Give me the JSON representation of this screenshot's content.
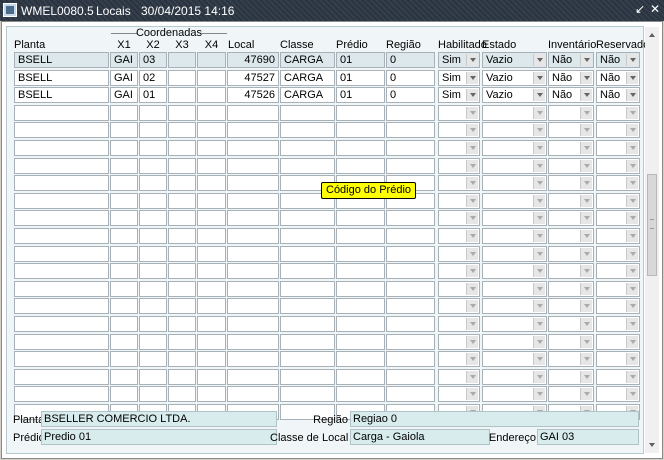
{
  "window": {
    "title": "WMEL0080.5",
    "screen": "Locais",
    "datetime": "30/04/2015 14:16",
    "restore_glyph": "↙",
    "close_glyph": "✕"
  },
  "table": {
    "group_label": "Coordenadas",
    "headers": {
      "planta": "Planta",
      "x1": "X1",
      "x2": "X2",
      "x3": "X3",
      "x4": "X4",
      "local": "Local",
      "classe": "Classe",
      "predio": "Prédio",
      "regiao": "Região",
      "habilitado": "Habilitado",
      "estado": "Estado",
      "inventario": "Inventário",
      "reservado": "Reservado"
    },
    "rows": [
      {
        "planta": "BSELL",
        "x1": "GAI",
        "x2": "03",
        "x3": "",
        "x4": "",
        "local": "47690",
        "classe": "CARGA",
        "predio": "01",
        "regiao": "0",
        "habilitado": "Sim",
        "estado": "Vazio",
        "inventario": "Não",
        "reservado": "Não"
      },
      {
        "planta": "BSELL",
        "x1": "GAI",
        "x2": "02",
        "x3": "",
        "x4": "",
        "local": "47527",
        "classe": "CARGA",
        "predio": "01",
        "regiao": "0",
        "habilitado": "Sim",
        "estado": "Vazio",
        "inventario": "Não",
        "reservado": "Não"
      },
      {
        "planta": "BSELL",
        "x1": "GAI",
        "x2": "01",
        "x3": "",
        "x4": "",
        "local": "47526",
        "classe": "CARGA",
        "predio": "01",
        "regiao": "0",
        "habilitado": "Sim",
        "estado": "Vazio",
        "inventario": "Não",
        "reservado": "Não"
      }
    ],
    "empty_rows": 18
  },
  "tooltip": "Código do Prédio",
  "detail": {
    "planta_label": "Planta",
    "planta_value": "BSELLER COMERCIO LTDA.",
    "regiao_label": "Região",
    "regiao_value": "Regiao 0",
    "predio_label": "Prédio",
    "predio_value": "Predio 01",
    "classe_local_label": "Classe de Local",
    "classe_local_value": "Carga - Gaiola",
    "endereco_label": "Endereço",
    "endereco_value": "GAI 03"
  }
}
